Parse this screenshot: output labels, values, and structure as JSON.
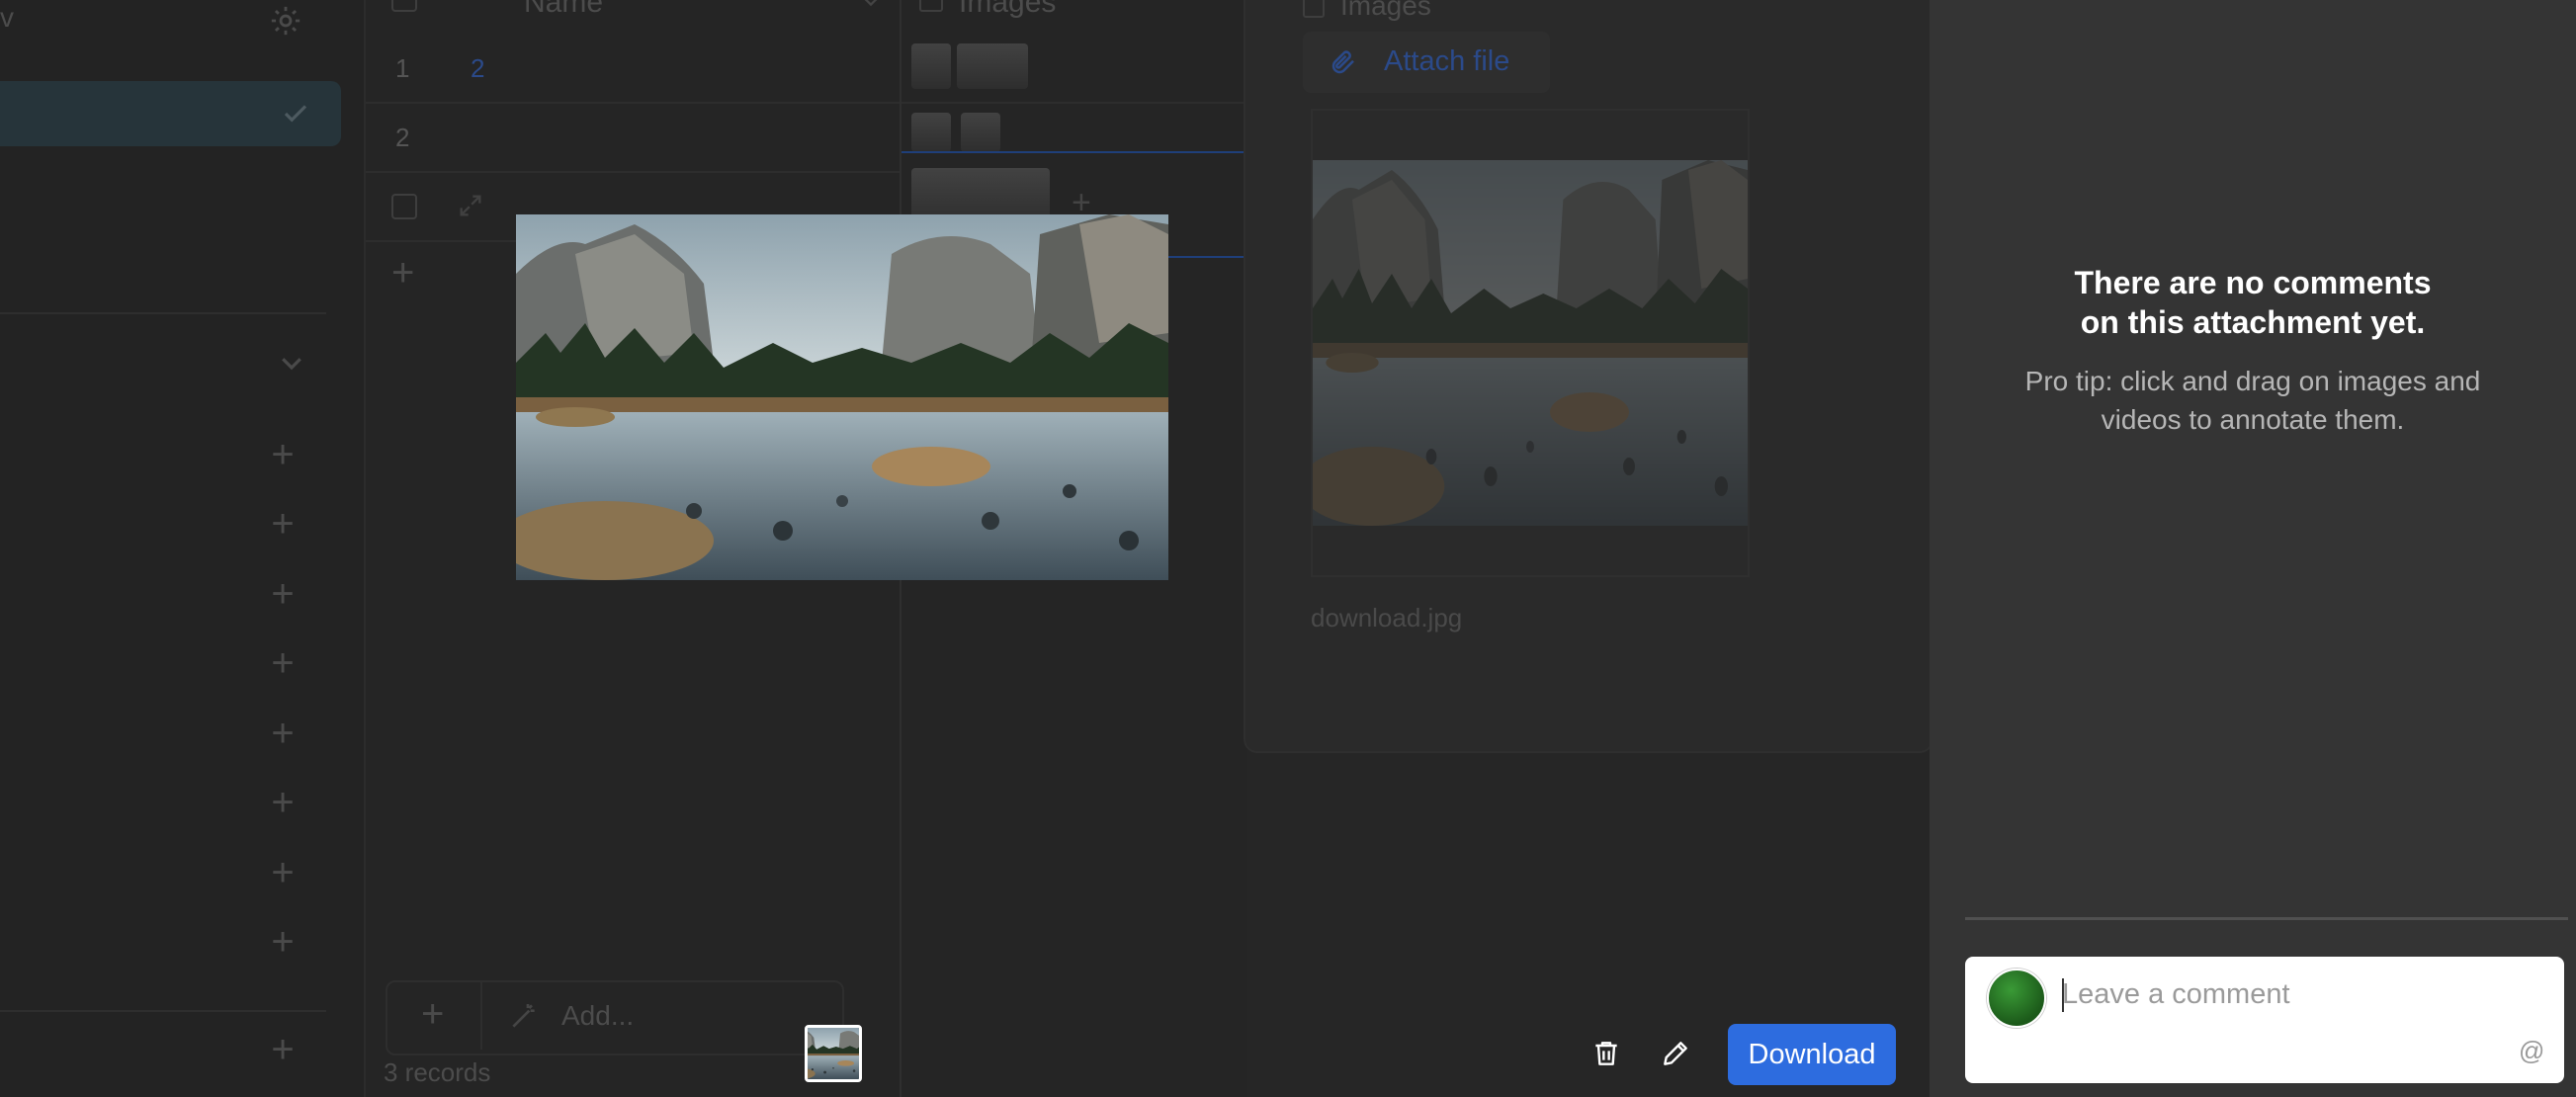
{
  "background_app": {
    "sidebar_truncated_char": "v",
    "name_column_header": "Name",
    "images_column_header": "Images",
    "rows": [
      {
        "number": "1",
        "name": "2"
      },
      {
        "number": "2",
        "name": ""
      }
    ],
    "add_button_label": "Add...",
    "records_count": "3 records",
    "record_card": {
      "field_label": "Images",
      "attach_label": "Attach file",
      "file_name": "download.jpg"
    }
  },
  "viewer": {
    "download_label": "Download",
    "delete_icon": "trash-icon",
    "edit_icon": "pencil-icon"
  },
  "comments": {
    "empty_title": "There are no comments on this attachment yet.",
    "empty_subtitle": "Pro tip: click and drag on images and videos to annotate them.",
    "input_placeholder": "Leave a comment",
    "mention_symbol": "@"
  },
  "colors": {
    "accent": "#2d6cdf",
    "panel_bg": "#343434",
    "overlay_bg": "#1f1f1f"
  }
}
